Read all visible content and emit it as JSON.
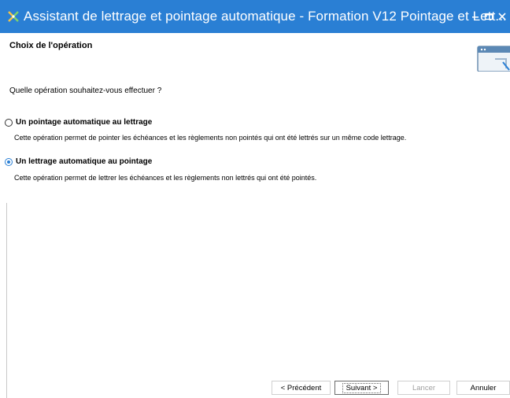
{
  "window": {
    "title": "Assistant de lettrage et pointage automatique - Formation V12 Pointage et Lett...",
    "icon": "wizard-app-icon",
    "accent_color": "#2a7fd4"
  },
  "header": {
    "title": "Choix de l'opération",
    "image_icon": "wizard-window-icon"
  },
  "content": {
    "question": "Quelle opération souhaitez-vous effectuer ?",
    "options": [
      {
        "label": "Un pointage automatique au lettrage",
        "description": "Cette opération permet de pointer les échéances et les règlements non pointés qui ont été lettrés sur un même code lettrage.",
        "selected": false
      },
      {
        "label": "Un lettrage automatique au pointage",
        "description": "Cette opération permet de lettrer les échéances et les règlements non lettrés qui ont été pointés.",
        "selected": true
      }
    ]
  },
  "buttons": {
    "previous": "< Précédent",
    "next": "Suivant >",
    "launch": "Lancer",
    "cancel": "Annuler"
  }
}
